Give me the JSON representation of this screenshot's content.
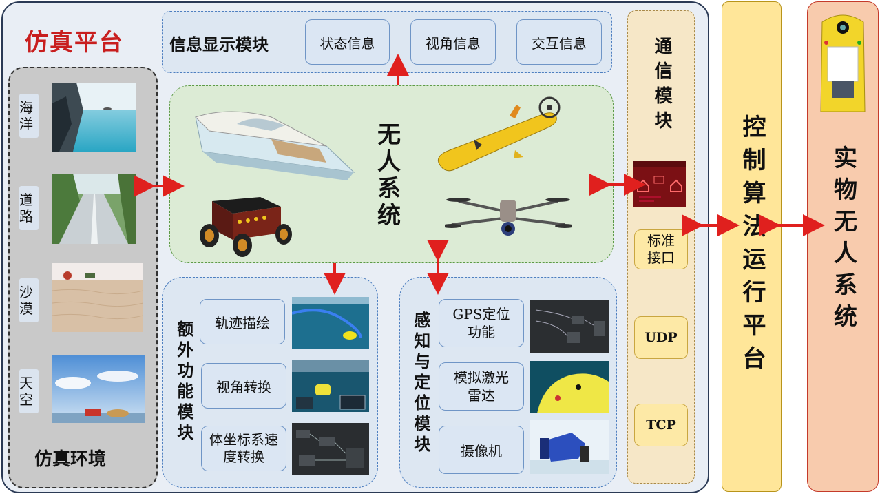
{
  "simulation_platform": {
    "title": "仿真平台",
    "environment": {
      "title": "仿真环境",
      "items": [
        {
          "label": "海洋"
        },
        {
          "label": "道路"
        },
        {
          "label": "沙漠"
        },
        {
          "label": "天空"
        }
      ]
    },
    "info_display": {
      "title": "信息显示模块",
      "items": [
        "状态信息",
        "视角信息",
        "交互信息"
      ]
    },
    "unmanned_system": {
      "title": "无人系统"
    },
    "extra_functions": {
      "title": "额外功能模块",
      "items": [
        "轨迹描绘",
        "视角转换",
        "体坐标系速度转换"
      ]
    },
    "perception": {
      "title": "感知与定位模块",
      "items": [
        "GPS定位功能",
        "模拟激光雷达",
        "摄像机"
      ]
    },
    "communication": {
      "title": "通信模块",
      "items": [
        "标准接口",
        "UDP",
        "TCP"
      ]
    }
  },
  "control_platform": {
    "title": "控制算法运行平台"
  },
  "physical_system": {
    "title": "实物无人系统"
  },
  "colors": {
    "accent_red": "#e0201e",
    "title_red": "#c81e1e",
    "platform_bg": "#e9eef5",
    "control_bg": "#ffe699",
    "physical_bg": "#f8cbad"
  }
}
